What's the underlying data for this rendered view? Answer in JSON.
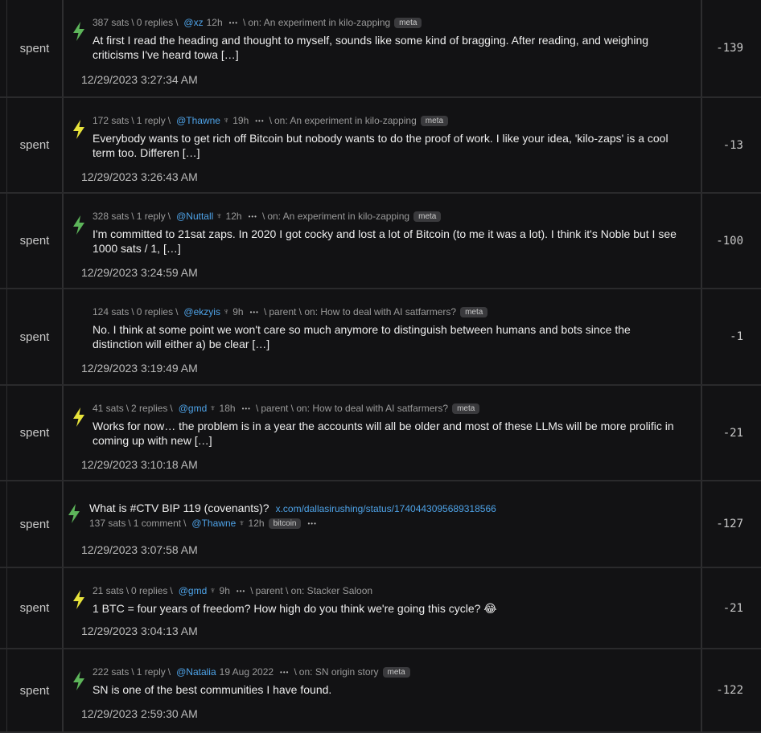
{
  "rows": [
    {
      "type": "spent",
      "sats": "387 sats",
      "replies": "0 replies",
      "user": "@xz",
      "ghost": false,
      "age": "12h",
      "context": "on: An experiment in kilo-zapping",
      "badge": "meta",
      "text": "At first I read the heading and thought to myself, sounds like some kind of bragging. After reading, and weighing criticisms I've heard towa […]",
      "date": "12/29/2023 3:27:34 AM",
      "amount": "-139",
      "bolt": "green"
    },
    {
      "type": "spent",
      "sats": "172 sats",
      "replies": "1 reply",
      "user": "@Thawne",
      "ghost": true,
      "age": "19h",
      "context": "on: An experiment in kilo-zapping",
      "badge": "meta",
      "text": "Everybody wants to get rich off Bitcoin but nobody wants to do the proof of work. I like your idea, 'kilo-zaps' is a cool term too. Differen […]",
      "date": "12/29/2023 3:26:43 AM",
      "amount": "-13",
      "bolt": "yellow"
    },
    {
      "type": "spent",
      "sats": "328 sats",
      "replies": "1 reply",
      "user": "@Nuttall",
      "ghost": true,
      "age": "12h",
      "context": "on: An experiment in kilo-zapping",
      "badge": "meta",
      "text": "I'm committed to 21sat zaps. In 2020 I got cocky and lost a lot of Bitcoin (to me it was a lot). I think it's Noble but I see 1000 sats / 1, […]",
      "date": "12/29/2023 3:24:59 AM",
      "amount": "-100",
      "bolt": "green"
    },
    {
      "type": "spent",
      "sats": "124 sats",
      "replies": "0 replies",
      "user": "@ekzyis",
      "ghost": true,
      "age": "9h",
      "context": "parent \\ on: How to deal with AI satfarmers?",
      "badge": "meta",
      "text": "No. I think at some point we won't care so much anymore to distinguish between humans and bots since the distinction will either a) be clear […]",
      "date": "12/29/2023 3:19:49 AM",
      "amount": "-1",
      "bolt": "none"
    },
    {
      "type": "spent",
      "sats": "41 sats",
      "replies": "2 replies",
      "user": "@gmd",
      "ghost": true,
      "age": "18h",
      "context": "parent \\ on: How to deal with AI satfarmers?",
      "badge": "meta",
      "text": "Works for now… the problem is in a year the accounts will all be older and most of these LLMs will be more prolific in coming up with new  […]",
      "date": "12/29/2023 3:10:18 AM",
      "amount": "-21",
      "bolt": "yellow"
    },
    {
      "type": "spent",
      "post": true,
      "title": "What is #CTV BIP 119 (covenants)?",
      "link": "x.com/dallasirushing/status/1740443095689318566",
      "sats": "137 sats",
      "replies": "1 comment",
      "user": "@Thawne",
      "ghost": true,
      "age": "12h",
      "badge": "bitcoin",
      "date": "12/29/2023 3:07:58 AM",
      "amount": "-127",
      "bolt": "green"
    },
    {
      "type": "spent",
      "sats": "21 sats",
      "replies": "0 replies",
      "user": "@gmd",
      "ghost": true,
      "age": "9h",
      "context": "parent \\ on: Stacker Saloon",
      "badge": "",
      "text": "1 BTC = four years of freedom?  How high do you think we're going this cycle? 😂",
      "date": "12/29/2023 3:04:13 AM",
      "amount": "-21",
      "bolt": "yellow"
    },
    {
      "type": "spent",
      "sats": "222 sats",
      "replies": "1 reply",
      "user": "@Natalia",
      "ghost": false,
      "age": "19 Aug 2022",
      "context": "on: SN origin story",
      "badge": "meta",
      "text": "SN is one of the best communities I have found.",
      "date": "12/29/2023 2:59:30 AM",
      "amount": "-122",
      "bolt": "green"
    }
  ],
  "colors": {
    "green": "#5db55a",
    "yellow": "#e7e33b",
    "link": "#4ea3e8"
  }
}
